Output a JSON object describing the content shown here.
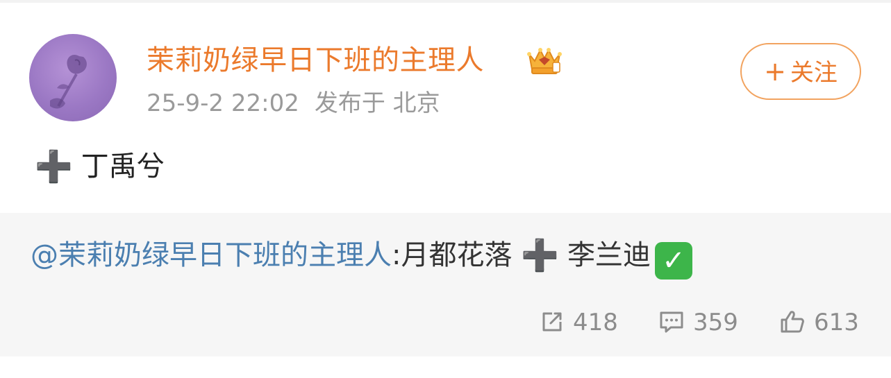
{
  "author": {
    "name": "茉莉奶绿早日下班的主理人",
    "avatar_icon": "avatar-rose-silhouette",
    "badge_icon": "crown-badge-icon"
  },
  "meta": {
    "time": "25-9-2 22:02",
    "location": "发布于 北京"
  },
  "follow_button": {
    "plus": "+",
    "label": "关注"
  },
  "post": {
    "plus_glyph": "➕",
    "text": "丁禹兮"
  },
  "repost": {
    "mention": "@茉莉奶绿早日下班的主理人",
    "text_before": ":月都花落",
    "plus_glyph": "➕",
    "text_after": "李兰迪",
    "check_glyph": "✓"
  },
  "actions": {
    "repost_count": "418",
    "comment_count": "359",
    "like_count": "613"
  },
  "colors": {
    "accent": "#eb7a2c",
    "mention": "#4b7fb0",
    "muted": "#9a9a9a",
    "check_green": "#3db54a"
  }
}
